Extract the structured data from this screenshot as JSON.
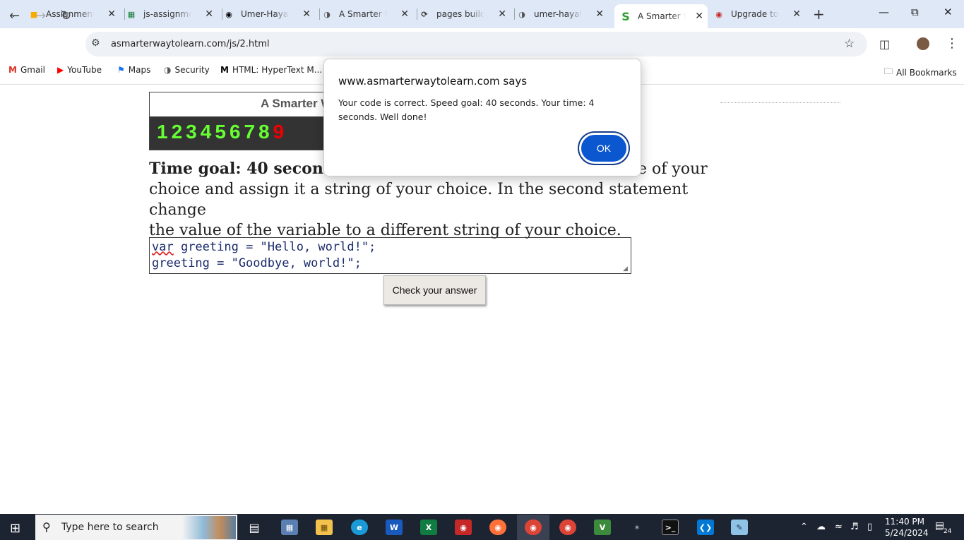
{
  "browser": {
    "tabs": [
      {
        "title": "Assignment",
        "icon": "google-classroom-icon",
        "color": "#f9ab00"
      },
      {
        "title": "js-assignment",
        "icon": "google-sheets-icon",
        "color": "#188038"
      },
      {
        "title": "Umer-Hayat",
        "icon": "github-icon",
        "color": "#000000"
      },
      {
        "title": "A Smarter W",
        "icon": "globe-icon",
        "color": "#555555"
      },
      {
        "title": "pages build",
        "icon": "github-actions-icon",
        "color": "#333333"
      },
      {
        "title": "umer-hayat",
        "icon": "globe-icon",
        "color": "#555555"
      },
      {
        "title": "A Smarter W",
        "icon": "smarter-way-icon",
        "color": "#2e9e2e"
      },
      {
        "title": "Upgrade to",
        "icon": "recorder-icon",
        "color": "#c62828"
      }
    ],
    "url": "asmarterwaytolearn.com/js/2.html",
    "bookmarks": [
      {
        "label": "Gmail",
        "icon": "gmail-icon",
        "color": "#d93025"
      },
      {
        "label": "YouTube",
        "icon": "youtube-icon",
        "color": "#ff0000"
      },
      {
        "label": "Maps",
        "icon": "maps-icon",
        "color": "#1a73e8"
      },
      {
        "label": "Security",
        "icon": "globe-icon",
        "color": "#555555"
      },
      {
        "label": "HTML: HyperText M...",
        "icon": "mdn-icon",
        "color": "#000000"
      }
    ],
    "all_bookmarks": "All Bookmarks"
  },
  "page": {
    "banner_title": "A Smarter W",
    "digits": [
      "1",
      "2",
      "3",
      "4",
      "5",
      "6",
      "7",
      "8",
      "9"
    ],
    "instruction_bold": "Time goal: 40 second",
    "instruction_line1_tail": "e of your",
    "instruction_line2": "choice and assign it a string of your choice. In the second statement change",
    "instruction_line3": "the value of the variable to a different string of your choice.",
    "code_line1_kw": "var",
    "code_line1_rest": " greeting = \"Hello, world!\";",
    "code_line2": "greeting = \"Goodbye, world!\";",
    "check_button": "Check your answer"
  },
  "dialog": {
    "title": "www.asmarterwaytolearn.com says",
    "message": "Your code is correct. Speed goal: 40 seconds. Your time: 4 seconds. Well done!",
    "ok": "OK"
  },
  "taskbar": {
    "search_placeholder": "Type here to search",
    "time": "11:40 PM",
    "date": "5/24/2024",
    "notification_count": "24",
    "apps": [
      {
        "name": "task-view-icon"
      },
      {
        "name": "file-explorer-alt-icon"
      },
      {
        "name": "file-explorer-icon"
      },
      {
        "name": "edge-icon"
      },
      {
        "name": "word-icon"
      },
      {
        "name": "excel-icon"
      },
      {
        "name": "recorder-icon"
      },
      {
        "name": "firefox-icon"
      },
      {
        "name": "chrome-icon"
      },
      {
        "name": "chrome-profile-icon"
      },
      {
        "name": "vite-icon"
      },
      {
        "name": "network-tool-icon"
      },
      {
        "name": "terminal-icon"
      },
      {
        "name": "vscode-icon"
      },
      {
        "name": "notepad-icon"
      }
    ]
  }
}
